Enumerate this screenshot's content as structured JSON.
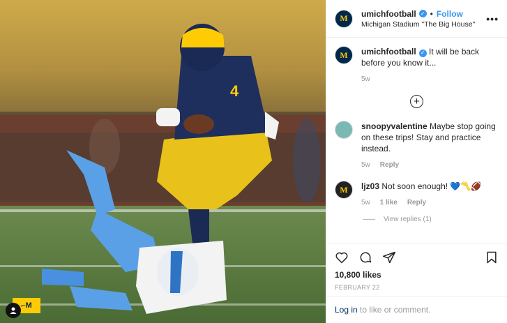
{
  "post": {
    "username": "umichfootball",
    "follow_label": "Follow",
    "separator": "•",
    "location": "Michigan Stadium \"The Big House\"",
    "more_label": "•••",
    "avatar_letter": "M",
    "likes": "10,800 likes",
    "date": "FEBRUARY 22"
  },
  "caption": {
    "username": "umichfootball",
    "text": " It will be back before you know it...",
    "time": "5w"
  },
  "load_more": "+",
  "comments": [
    {
      "username": "snoopyvalentine",
      "text": " Maybe stop going on these trips! Stay and practice instead.",
      "time": "5w",
      "reply": "Reply"
    },
    {
      "username": "ljz03",
      "text": " Not soon enough! 💙〽️🏈",
      "time": "5w",
      "likes": "1 like",
      "reply": "Reply"
    }
  ],
  "view_replies": "View replies (1)",
  "login": {
    "link": "Log in",
    "text": " to like or comment."
  },
  "photo": {
    "jersey_number": "4"
  },
  "colors": {
    "maize": "#ffcb05",
    "blue": "#00274c",
    "link": "#3897f0"
  }
}
